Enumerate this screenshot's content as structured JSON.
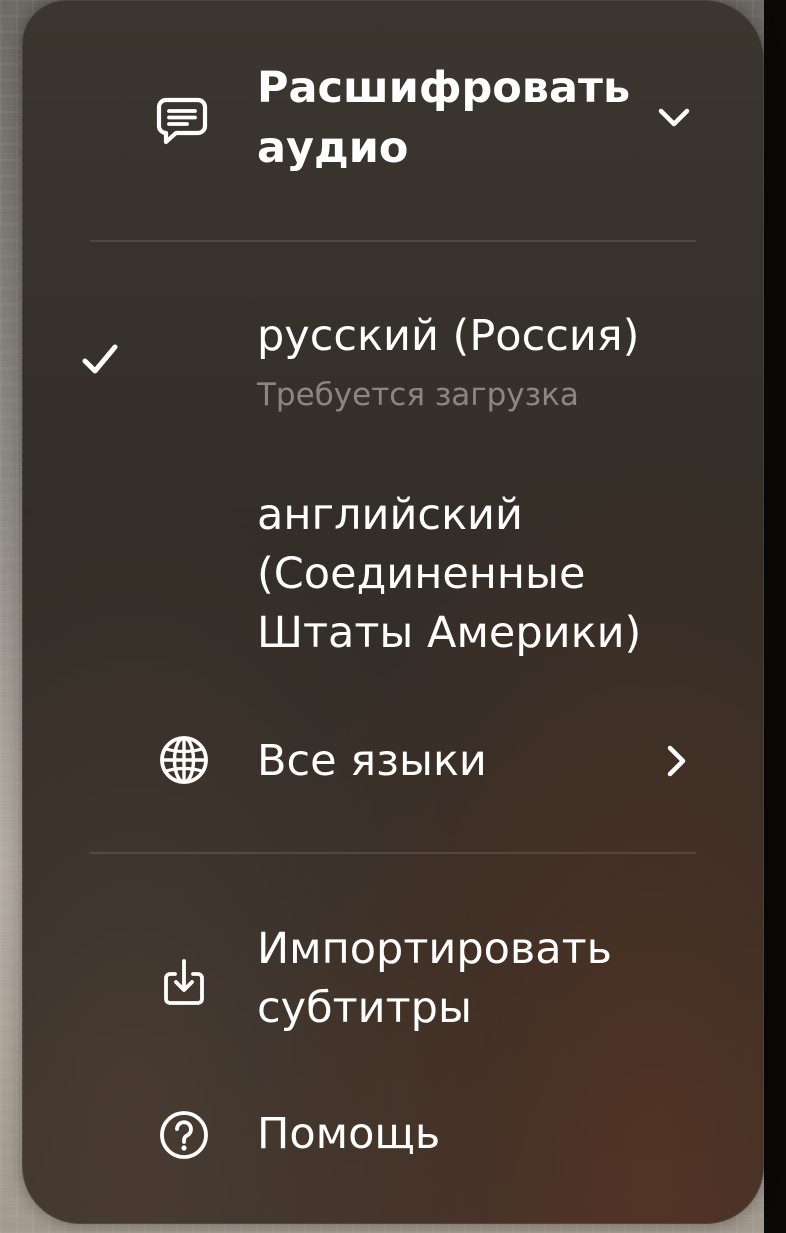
{
  "menu": {
    "transcribe": {
      "icon": "speech-bubble-icon",
      "line1": "Расшифровать",
      "line2": "аудио",
      "chevron": "chevron-down-icon"
    },
    "languages": [
      {
        "selected": true,
        "check_icon": "checkmark-icon",
        "name": "русский (Россия)",
        "subtitle": "Требуется загрузка"
      },
      {
        "selected": false,
        "line1": "английский",
        "line2": "(Соединенные",
        "line3": "Штаты Америки)"
      }
    ],
    "all_languages": {
      "icon": "globe-icon",
      "label": "Все языки",
      "chevron": "chevron-right-icon"
    },
    "import_subtitles": {
      "icon": "import-icon",
      "line1": "Импортировать",
      "line2": "субтитры"
    },
    "help": {
      "icon": "help-icon",
      "label": "Помощь"
    }
  }
}
